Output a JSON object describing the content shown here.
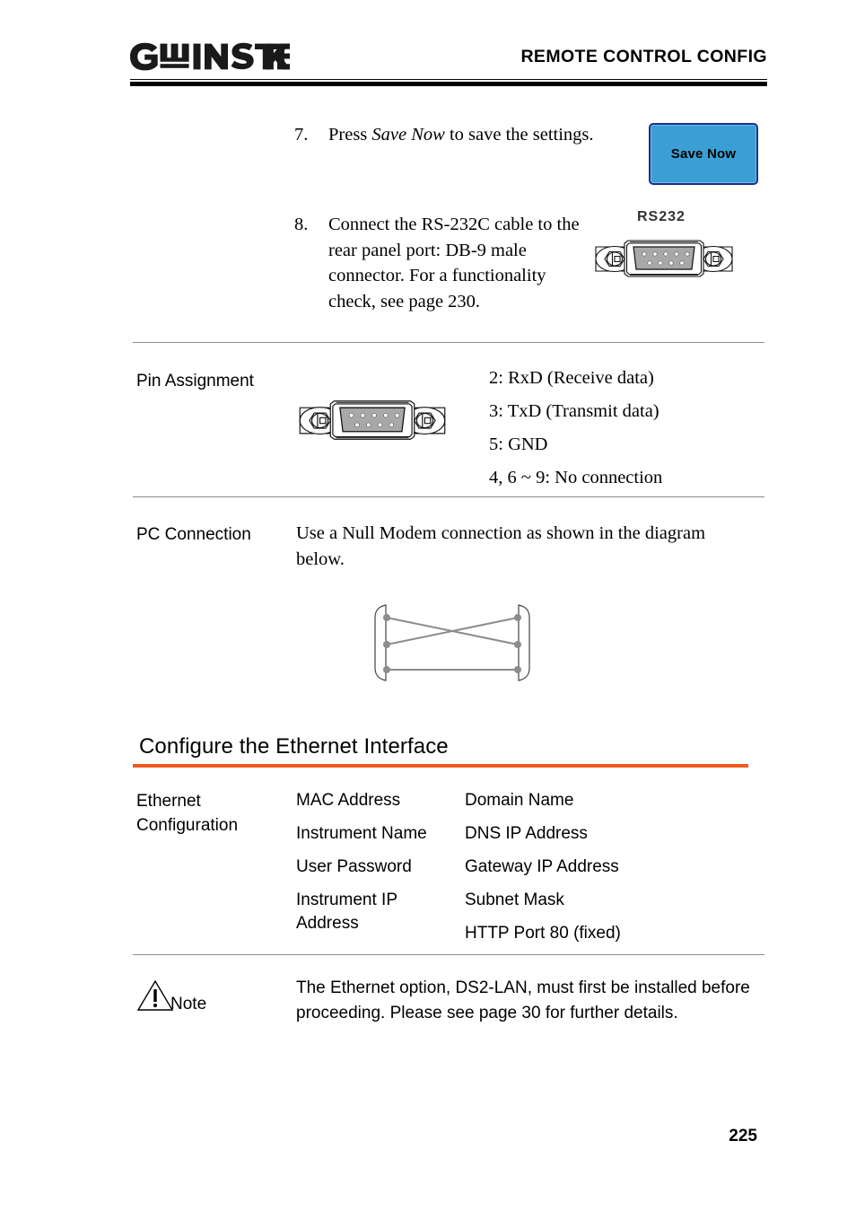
{
  "header": {
    "logo_text": "GW INSTEK",
    "title": "REMOTE CONTROL CONFIG"
  },
  "steps": [
    {
      "number": "7.",
      "text_before": "Press ",
      "text_italic": "Save Now",
      "text_after": " to save the settings."
    },
    {
      "number": "8.",
      "text": "Connect the RS-232C cable to the rear panel port: DB-9 male connector. For a functionality check, see page 230."
    }
  ],
  "save_now_button": {
    "label": "Save Now",
    "fill_color": "#3a9fd4",
    "border_color": "#1e2f8f"
  },
  "rs232_graphic": {
    "caption": "RS232"
  },
  "pin_assignment": {
    "label": "Pin Assignment",
    "pins": [
      "2: RxD (Receive data)",
      "3: TxD (Transmit data)",
      "5: GND",
      "4, 6 ~ 9: No connection"
    ]
  },
  "pc_connection": {
    "label": "PC Connection",
    "text": "Use a Null Modem connection as shown in the diagram below."
  },
  "ethernet_section": {
    "heading": "Configure the Ethernet Interface",
    "accent_color": "#ee5a1f",
    "config_label": "Ethernet Configuration",
    "column_1": [
      "MAC Address",
      "Instrument Name",
      "User Password",
      "Instrument IP Address"
    ],
    "column_2": [
      "Domain Name",
      "DNS IP Address",
      "Gateway IP Address",
      "Subnet Mask",
      "HTTP Port 80 (fixed)"
    ]
  },
  "note": {
    "icon": "warning-triangle-icon",
    "label": "Note",
    "text": "The Ethernet option, DS2-LAN, must first be installed before proceeding. Please see page 30 for further details."
  },
  "footer": {
    "page_number": "225"
  }
}
